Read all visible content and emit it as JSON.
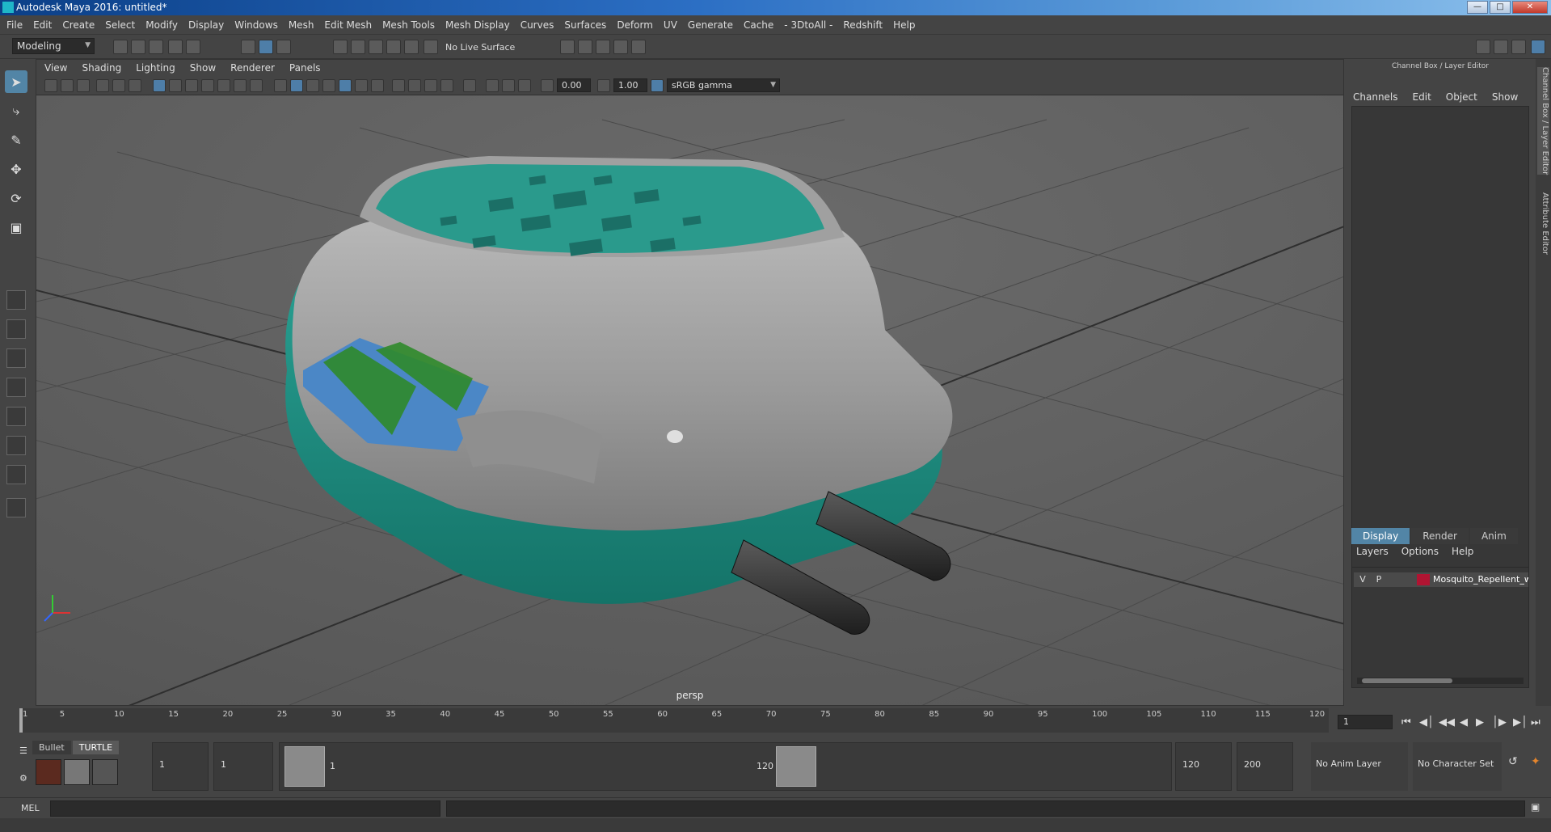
{
  "window": {
    "title": "Autodesk Maya 2016: untitled*"
  },
  "menubar": [
    "File",
    "Edit",
    "Create",
    "Select",
    "Modify",
    "Display",
    "Windows",
    "Mesh",
    "Edit Mesh",
    "Mesh Tools",
    "Mesh Display",
    "Curves",
    "Surfaces",
    "Deform",
    "UV",
    "Generate",
    "Cache",
    "- 3DtoAll -",
    "Redshift",
    "Help"
  ],
  "status_line": {
    "mode": "Modeling",
    "live_surface": "No Live Surface"
  },
  "panel": {
    "menus": [
      "View",
      "Shading",
      "Lighting",
      "Show",
      "Renderer",
      "Panels"
    ],
    "exposure": "0.00",
    "gamma": "1.00",
    "color_space": "sRGB gamma",
    "camera": "persp"
  },
  "channel_box": {
    "title": "Channel Box / Layer Editor",
    "menus": [
      "Channels",
      "Edit",
      "Object",
      "Show"
    ]
  },
  "layer_editor": {
    "tabs": [
      "Display",
      "Render",
      "Anim"
    ],
    "active_tab": "Display",
    "menus": [
      "Layers",
      "Options",
      "Help"
    ],
    "layers": [
      {
        "v": "V",
        "p": "P",
        "name": "Mosquito_Repellent_wit",
        "color": "#b01432"
      }
    ]
  },
  "side_tabs": [
    "Channel Box / Layer Editor",
    "Attribute Editor"
  ],
  "time_slider": {
    "ticks": [
      "1",
      "5",
      "10",
      "15",
      "20",
      "25",
      "30",
      "35",
      "40",
      "45",
      "50",
      "55",
      "60",
      "65",
      "70",
      "75",
      "80",
      "85",
      "90",
      "95",
      "100",
      "105",
      "110",
      "115",
      "120"
    ],
    "current_frame": "1"
  },
  "shelf": {
    "tabs": [
      "Bullet",
      "TURTLE"
    ],
    "active_tab": "TURTLE"
  },
  "range_slider": {
    "start_time": "1",
    "playback_start": "1",
    "range_start_label": "1",
    "range_end_label": "120",
    "playback_end": "120",
    "end_time": "200",
    "anim_layer": "No Anim Layer",
    "character_set": "No Character Set"
  },
  "command_line": {
    "language": "MEL"
  },
  "colors": {
    "accent": "#5285a6",
    "teal": "#1d8f82",
    "layer_red": "#b01432"
  }
}
